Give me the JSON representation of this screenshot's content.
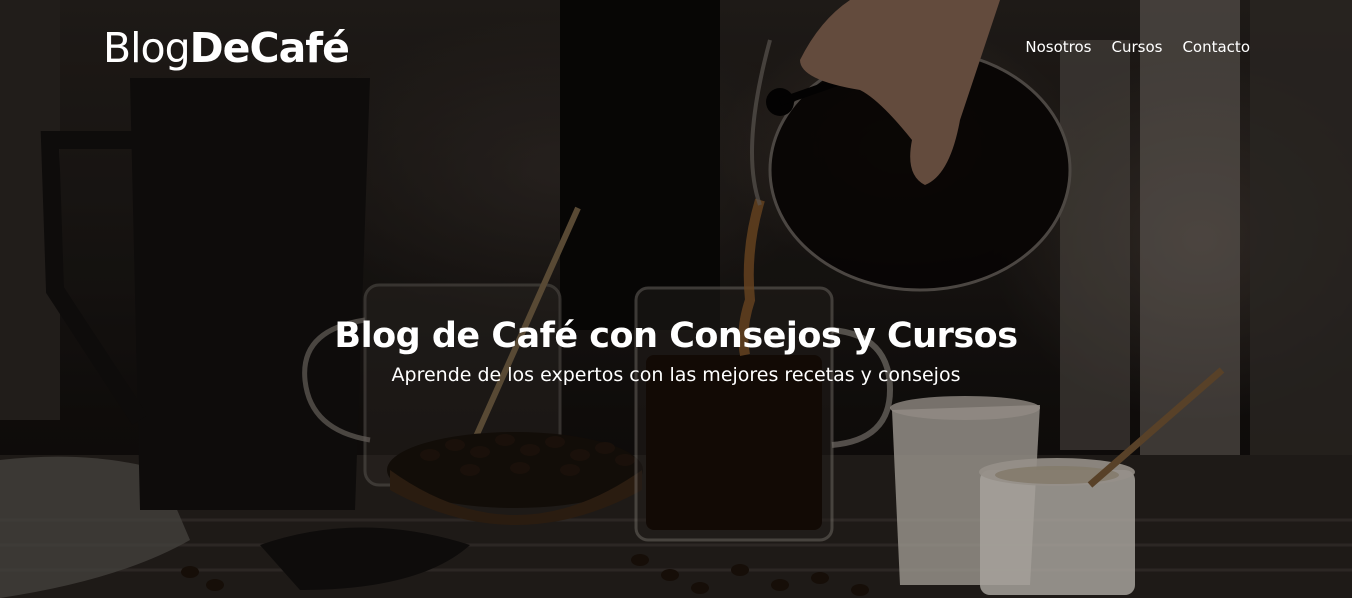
{
  "header": {
    "logo_light": "Blog",
    "logo_bold": "DeCafé"
  },
  "nav": {
    "items": [
      {
        "label": "Nosotros"
      },
      {
        "label": "Cursos"
      },
      {
        "label": "Contacto"
      }
    ]
  },
  "hero": {
    "title": "Blog de Café con Consejos y Cursos",
    "subtitle": "Aprende de los expertos con las mejores recetas y consejos",
    "background_icon": "coffee-pour-photo"
  },
  "colors": {
    "text": "#ffffff",
    "background": "#1a1512",
    "coffee": "#2b1a10",
    "cup_white": "#e8e2da"
  }
}
